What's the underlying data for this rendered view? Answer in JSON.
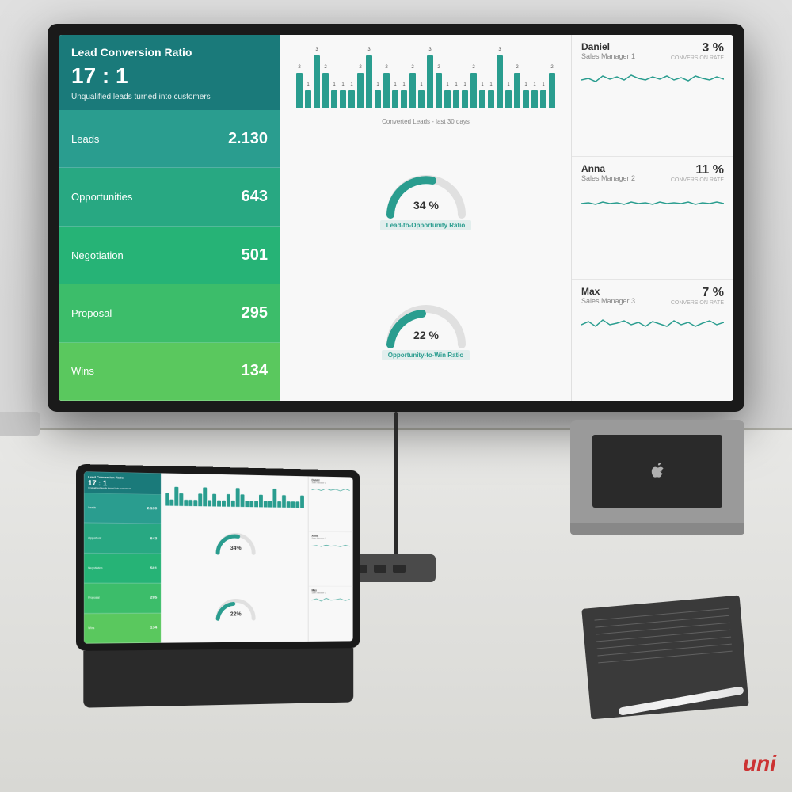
{
  "dashboard": {
    "lcr": {
      "title": "Lead Conversion Ratio",
      "ratio": "17 : 1",
      "subtitle": "Unqualified leads turned into customers"
    },
    "metrics": [
      {
        "label": "Leads",
        "value": "2.130"
      },
      {
        "label": "Opportunities",
        "value": "643"
      },
      {
        "label": "Negotiation",
        "value": "501"
      },
      {
        "label": "Proposal",
        "value": "295"
      },
      {
        "label": "Wins",
        "value": "134"
      }
    ],
    "gauges": [
      {
        "label": "Lead-to-Opportunity Ratio",
        "pct": "34 %",
        "value": 34
      },
      {
        "label": "Opportunity-to-Win Ratio",
        "pct": "22 %",
        "value": 22
      }
    ],
    "barchart": {
      "title": "Converted Leads - last 30 days",
      "bars": [
        2,
        1,
        3,
        2,
        1,
        1,
        1,
        2,
        3,
        1,
        2,
        1,
        1,
        2,
        1,
        3,
        2,
        1,
        1,
        1,
        2,
        1,
        1,
        3,
        1,
        2,
        1,
        1,
        1,
        2
      ]
    },
    "salespeople": [
      {
        "name": "Daniel",
        "role": "Sales Manager 1",
        "pct": "3 %",
        "pct_label": "CONVERSION RATE"
      },
      {
        "name": "Anna",
        "role": "Sales Manager 2",
        "pct": "11 %",
        "pct_label": "CONVERSION RATE"
      },
      {
        "name": "Max",
        "role": "Sales Manager 3",
        "pct": "7 %",
        "pct_label": "CONVERSION RATE"
      }
    ]
  },
  "tablet": {
    "metrics": [
      {
        "label": "Leads",
        "value": "2.130"
      },
      {
        "label": "Opportunit...",
        "value": "643"
      },
      {
        "label": "Negotiation",
        "value": "501"
      },
      {
        "label": "Proposal",
        "value": "295"
      },
      {
        "label": "Wins",
        "value": "134"
      }
    ]
  },
  "branding": {
    "logo": "uni"
  }
}
